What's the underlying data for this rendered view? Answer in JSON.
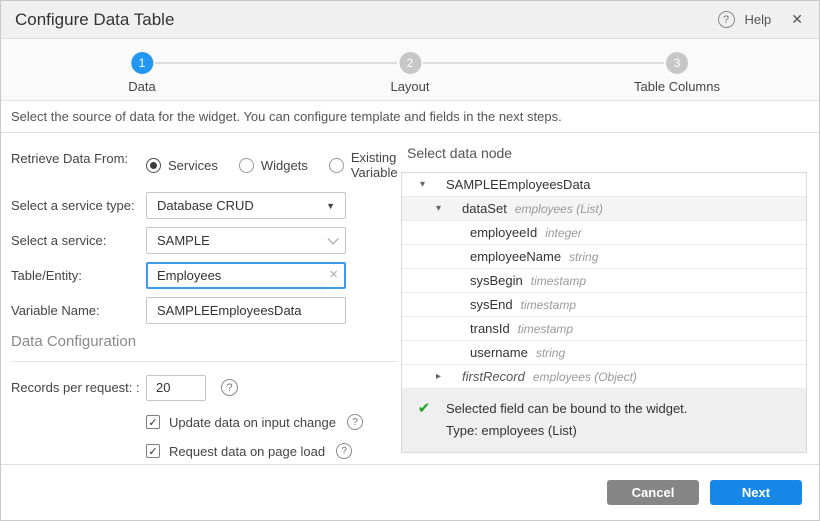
{
  "dialog": {
    "title": "Configure Data Table",
    "help_label": "Help"
  },
  "icons": {
    "help_glyph": "?",
    "close_glyph": "✕",
    "caret_down": "▾",
    "caret_right": "▸",
    "select_arrow": "▼",
    "clear_glyph": "×",
    "check_glyph": "✔",
    "green_check": "✔"
  },
  "colors": {
    "accent_blue": "#2196f3",
    "next_blue": "#1787e8",
    "cancel_gray": "#868686",
    "check_green": "#1fa51f",
    "focus_border": "#3d9be9"
  },
  "stepper": {
    "steps": [
      {
        "number": "1",
        "label": "Data",
        "active": true
      },
      {
        "number": "2",
        "label": "Layout",
        "active": false
      },
      {
        "number": "3",
        "label": "Table Columns",
        "active": false
      }
    ]
  },
  "description": "Select the source of data for the widget. You can configure template and fields in the next steps.",
  "form": {
    "retrieve_label": "Retrieve Data From:",
    "retrieve_options": [
      {
        "label": "Services",
        "selected": true
      },
      {
        "label": "Widgets",
        "selected": false
      },
      {
        "label": "Existing Variable",
        "selected": false
      }
    ],
    "service_type_label": "Select a service type:",
    "service_type_value": "Database CRUD",
    "service_label": "Select a service:",
    "service_value": "SAMPLE",
    "table_entity_label": "Table/Entity:",
    "table_entity_value": "Employees",
    "variable_name_label": "Variable Name:",
    "variable_name_value": "SAMPLEEmployeesData",
    "section_header": "Data Configuration",
    "records_label": "Records per request: :",
    "records_value": "20",
    "checkboxes": [
      {
        "label": "Update data on input change",
        "checked": true
      },
      {
        "label": "Request data on page load",
        "checked": true
      }
    ]
  },
  "data_node": {
    "header": "Select data node",
    "rows": [
      {
        "name": "SAMPLEEmployeesData",
        "type": "",
        "arrow": "down",
        "indent": 0,
        "italic_name": false,
        "selected": false
      },
      {
        "name": "dataSet",
        "type": "employees (List)",
        "arrow": "down",
        "indent": 1,
        "italic_name": false,
        "selected": true
      },
      {
        "name": "employeeId",
        "type": "integer",
        "arrow": null,
        "indent": 2,
        "italic_name": false,
        "selected": false
      },
      {
        "name": "employeeName",
        "type": "string",
        "arrow": null,
        "indent": 2,
        "italic_name": false,
        "selected": false
      },
      {
        "name": "sysBegin",
        "type": "timestamp",
        "arrow": null,
        "indent": 2,
        "italic_name": false,
        "selected": false
      },
      {
        "name": "sysEnd",
        "type": "timestamp",
        "arrow": null,
        "indent": 2,
        "italic_name": false,
        "selected": false
      },
      {
        "name": "transId",
        "type": "timestamp",
        "arrow": null,
        "indent": 2,
        "italic_name": false,
        "selected": false
      },
      {
        "name": "username",
        "type": "string",
        "arrow": null,
        "indent": 2,
        "italic_name": false,
        "selected": false
      },
      {
        "name": "firstRecord",
        "type": "employees (Object)",
        "arrow": "right",
        "indent": 1,
        "italic_name": true,
        "selected": false
      }
    ],
    "info": {
      "line1": "Selected field can be bound to the widget.",
      "line2": "Type: employees (List)"
    }
  },
  "footer": {
    "cancel_label": "Cancel",
    "next_label": "Next"
  }
}
